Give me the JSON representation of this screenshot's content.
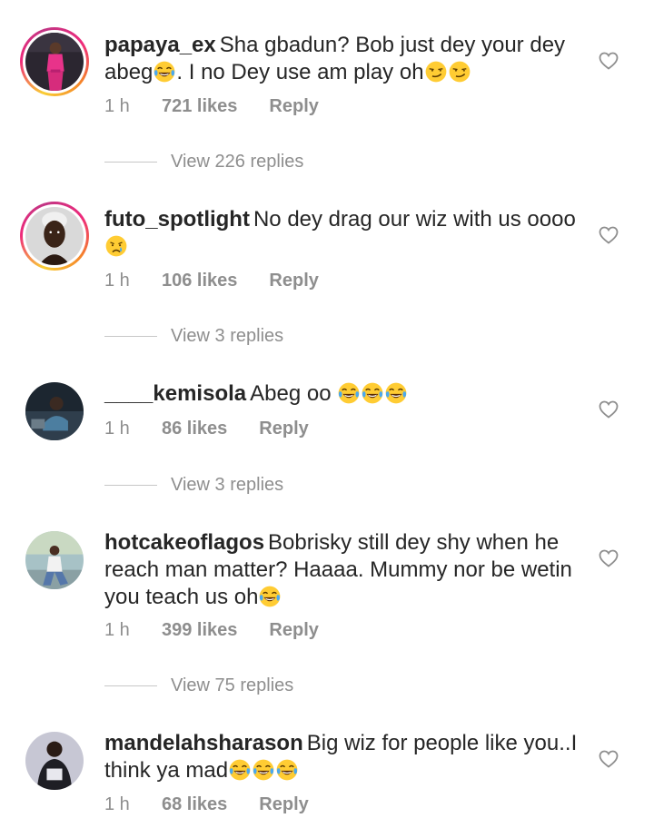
{
  "comments": [
    {
      "username": "papaya_ex",
      "text_part1": "Sha gbadun? Bob just dey your dey abeg",
      "text_part2": ". I no Dey use am play oh",
      "emoji_1": "joy-emoji",
      "emoji_2": "smirk-emoji",
      "time": "1 h",
      "likes": "721 likes",
      "reply": "Reply",
      "view_replies": "View 226 replies"
    },
    {
      "username": "futo_spotlight",
      "text_part1": "No dey drag our wiz with us oooo",
      "emoji_1": "crying-emoji",
      "time": "1 h",
      "likes": "106 likes",
      "reply": "Reply",
      "view_replies": "View 3 replies"
    },
    {
      "username": "____kemisola",
      "text_part1": "Abeg oo ",
      "emoji_1": "joy-emoji",
      "time": "1 h",
      "likes": "86 likes",
      "reply": "Reply",
      "view_replies": "View 3 replies"
    },
    {
      "username": "hotcakeoflagos",
      "text_part1": "Bobrisky still dey shy when he reach man matter? Haaaa. Mummy nor be wetin you teach us oh",
      "emoji_1": "joy-emoji",
      "time": "1 h",
      "likes": "399 likes",
      "reply": "Reply",
      "view_replies": "View 75 replies"
    },
    {
      "username": "mandelahsharason",
      "text_part1": "Big wiz for people like you..I think ya mad",
      "emoji_1": "joy-emoji",
      "time": "1 h",
      "likes": "68 likes",
      "reply": "Reply"
    }
  ],
  "icons": {
    "like": "heart-outline-icon"
  },
  "colors": {
    "text": "#262626",
    "muted": "#8e8e8e",
    "story_ring_start": "#f9ce34",
    "story_ring_mid": "#ee2a7b",
    "story_ring_end": "#c13584"
  }
}
